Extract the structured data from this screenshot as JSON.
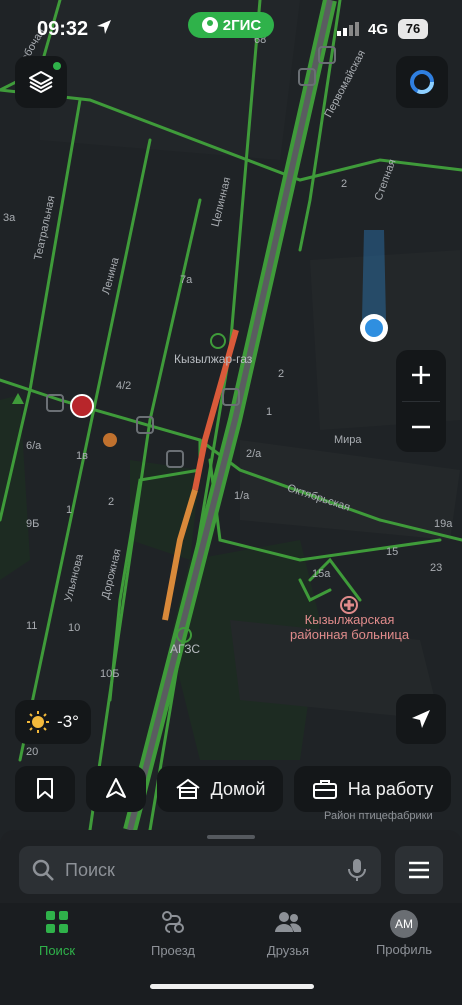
{
  "status_bar": {
    "time": "09:32",
    "network": "4G",
    "battery": "76"
  },
  "brand": {
    "name": "2ГИС"
  },
  "colors": {
    "accent": "#2fb24a",
    "road_green": "#3f9b3a",
    "traffic_orange": "#d9893a",
    "traffic_red": "#d95a3a",
    "hospital": "#e08b8b",
    "location": "#2f8fe0"
  },
  "map": {
    "streets": [
      "Рабочая",
      "Первомайская",
      "Театральная",
      "Ленина",
      "Целинная",
      "Степная",
      "Мира",
      "Октябрьская",
      "Ульянова",
      "Дорожная"
    ],
    "house_numbers": [
      "3a",
      "2",
      "7a",
      "4/2",
      "2",
      "1",
      "6/a",
      "1в",
      "2/а",
      "1/а",
      "9Б",
      "1",
      "2",
      "15",
      "15а",
      "23",
      "19а",
      "11",
      "10",
      "10Б",
      "20",
      "68"
    ],
    "pois": {
      "gas_company": "Кызылжар-газ",
      "gas_station": "АГЗС"
    },
    "hospital": {
      "line1": "Кызылжарская",
      "line2": "районная больница"
    },
    "district": "Район птицефабрики",
    "icons": [
      "layers-icon",
      "compass-icon",
      "zoom-in-icon",
      "zoom-out-icon",
      "my-location-icon",
      "bus-stop-icon",
      "hospital-icon",
      "restaurant-icon"
    ]
  },
  "weather": {
    "temp": "-3°",
    "icon": "sun-icon"
  },
  "quick_actions": {
    "home": "Домой",
    "work": "На работу"
  },
  "search": {
    "placeholder": "Поиск"
  },
  "tabs": {
    "search": "Поиск",
    "route": "Проезд",
    "friends": "Друзья",
    "profile": "Профиль",
    "avatar_initials": "AM",
    "active": "search"
  }
}
